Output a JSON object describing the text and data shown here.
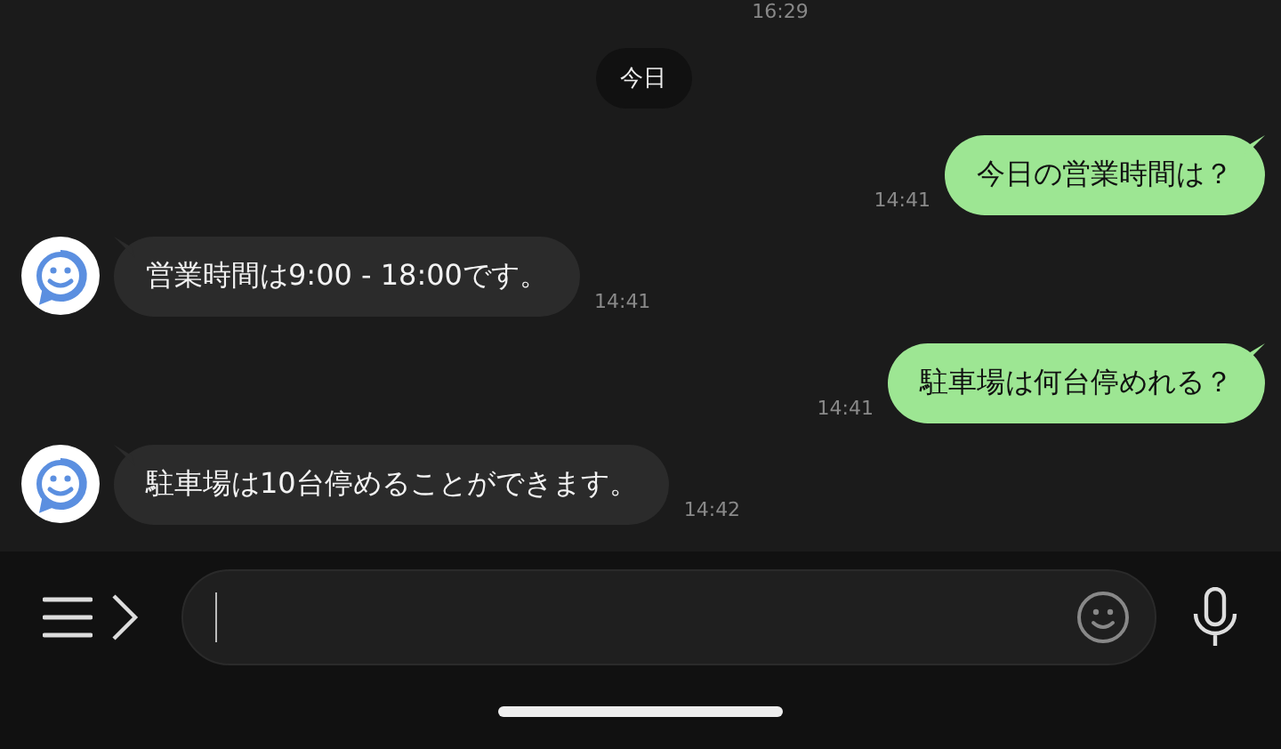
{
  "top_time": "16:29",
  "date_divider": "今日",
  "messages": [
    {
      "kind": "sent",
      "text": "今日の営業時間は？",
      "time": "14:41"
    },
    {
      "kind": "received",
      "text": "営業時間は9:00 - 18:00です。",
      "time": "14:41"
    },
    {
      "kind": "sent",
      "text": "駐車場は何台停めれる？",
      "time": "14:41"
    },
    {
      "kind": "received",
      "text": "駐車場は10台停めることができます。",
      "time": "14:42"
    }
  ]
}
